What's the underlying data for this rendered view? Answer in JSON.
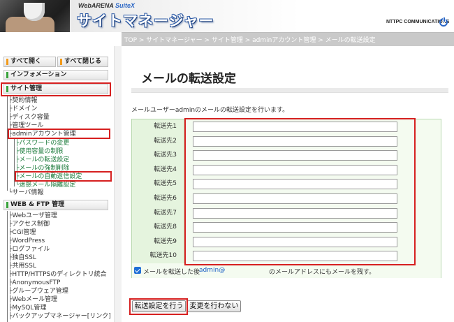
{
  "header": {
    "brand_logo_prefix": "WebARENA",
    "brand_logo_suffix": "SuiteX",
    "app_title": "サイトマネージャー",
    "company_logo": "NTTPC COMMUNICATIONS",
    "power_icon": "power-icon"
  },
  "breadcrumb": "TOP > サイトマネージャー > サイト管理 > adminアカウント管理 > メールの転送設定",
  "sidebar": {
    "expand_all": "すべて開く",
    "collapse_all": "すべて閉じる",
    "sections": {
      "info": "インフォメーション",
      "site": "サイト管理",
      "web_ftp": "WEB & FTP 管理"
    },
    "site_items": [
      "契約情報",
      "ドメイン",
      "ディスク容量",
      "管理ツール",
      "adminアカウント管理"
    ],
    "admin_items": [
      "パスワードの変更",
      "使用容量の制限",
      "メールの転送設定",
      "メールの強制削除",
      "メールの自動返信設定",
      "迷惑メール隔離設定"
    ],
    "server_info": "サーバ情報",
    "web_items": [
      "Webユーザ管理",
      "アクセス制御",
      "CGI管理",
      "WordPress",
      "ログファイル",
      "独自SSL",
      "共用SSL",
      "HTTP/HTTPSのディレクトリ統合",
      "AnonymousFTP",
      "グループウェア管理",
      "Webメール管理",
      "MySQL管理",
      "バックアップマネージャー[リンク]"
    ]
  },
  "main": {
    "page_title": "メールの転送設定",
    "description": "メールユーザーadminのメールの転送設定を行います。",
    "forward_labels": [
      "転送先1",
      "転送先2",
      "転送先3",
      "転送先4",
      "転送先5",
      "転送先6",
      "転送先7",
      "転送先8",
      "転送先9",
      "転送先10"
    ],
    "forward_values": [
      "",
      "",
      "",
      "",
      "",
      "",
      "",
      "",
      "",
      ""
    ],
    "keep_checked": true,
    "keep_text_1": "メールを転送した後",
    "keep_account": "admin@",
    "keep_text_2": "のメールアドレスにもメールを残す。",
    "apply_label": "転送設定を行う",
    "cancel_label": "変更を行わない"
  },
  "colors": {
    "accent_orange": "#f29a1a",
    "accent_green": "#38a33a",
    "highlight_red": "#d62020",
    "table_label_bg": "#e5f4de"
  }
}
